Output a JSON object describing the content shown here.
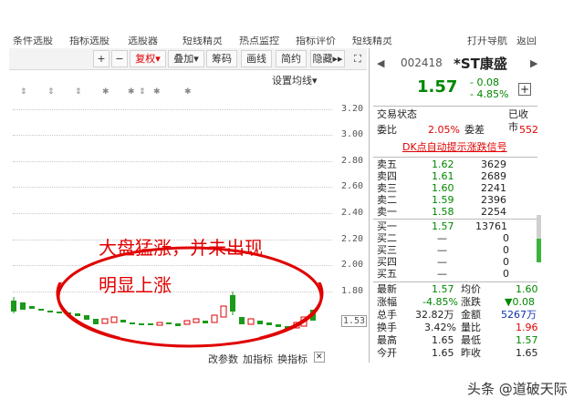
{
  "top_menu": [
    "条件选股",
    "指标选股",
    "选股器",
    "短线精灵",
    "热点监控",
    "指标评价",
    "短线精灵",
    "打开导航",
    "返回"
  ],
  "toolbar": {
    "plus": "+",
    "minus": "−",
    "fuquan": "复权",
    "fuquan_arrow": "▾",
    "diejia": "叠加",
    "diejia_arrow": "▾",
    "chouma": "筹码",
    "huaxian": "画线",
    "jianyue": "简约",
    "yincang": "隐藏",
    "yincang_arrow": "▸▸",
    "expand": "⛶"
  },
  "chart": {
    "settings_label": "设置均线",
    "settings_arrow": "▾",
    "event_markers": [
      "⇕",
      "⇕",
      "⇕",
      "✱",
      "✱",
      "⇕",
      "✱",
      "✱"
    ],
    "y_ticks": [
      "3.20",
      "3.00",
      "2.80",
      "2.60",
      "2.40",
      "2.20",
      "2.00",
      "1.80",
      "1.53"
    ],
    "current_price_label": "1.53",
    "bottom_links": [
      "改参数",
      "加指标",
      "换指标"
    ],
    "close_icon": "✕"
  },
  "annotation": {
    "line1": "大盘猛涨，并未出现",
    "line2": "明显上涨",
    "color": "#e00000"
  },
  "quote": {
    "prev_arrow": "◀",
    "next_arrow": "▶",
    "code": "002418",
    "name": "*ST康盛",
    "price": "1.57",
    "change": "- 0.08",
    "change_pct": "- 4.85%",
    "add_icon": "+",
    "status_label": "交易状态",
    "status_value": "已收市",
    "weibi_label": "委比",
    "weibi_value": "2.05%",
    "weicha_label": "委差",
    "weicha_value": "552",
    "signal_link": "DK点自动提示涨跌信号",
    "sell": [
      {
        "label": "卖五",
        "price": "1.62",
        "vol": "3629"
      },
      {
        "label": "卖四",
        "price": "1.61",
        "vol": "2689"
      },
      {
        "label": "卖三",
        "price": "1.60",
        "vol": "2241"
      },
      {
        "label": "卖二",
        "price": "1.59",
        "vol": "2396"
      },
      {
        "label": "卖一",
        "price": "1.58",
        "vol": "2254"
      }
    ],
    "buy": [
      {
        "label": "买一",
        "price": "1.57",
        "vol": "13761"
      },
      {
        "label": "买二",
        "price": "—",
        "vol": "0"
      },
      {
        "label": "买三",
        "price": "—",
        "vol": "0"
      },
      {
        "label": "买四",
        "price": "—",
        "vol": "0"
      },
      {
        "label": "买五",
        "price": "—",
        "vol": "0"
      }
    ],
    "stats": [
      {
        "l1": "最新",
        "v1": "1.57",
        "l2": "均价",
        "v2": "1.60"
      },
      {
        "l1": "涨幅",
        "v1": "-4.85%",
        "l2": "涨跌",
        "v2": "▼0.08"
      },
      {
        "l1": "总手",
        "v1": "32.82万",
        "l2": "金额",
        "v2": "5267万"
      },
      {
        "l1": "换手",
        "v1": "3.42%",
        "l2": "量比",
        "v2": "1.96"
      },
      {
        "l1": "最高",
        "v1": "1.65",
        "l2": "最低",
        "v2": "1.57"
      },
      {
        "l1": "今开",
        "v1": "1.65",
        "l2": "昨收",
        "v2": "1.65"
      }
    ]
  },
  "watermark": "头条 @道破天际"
}
